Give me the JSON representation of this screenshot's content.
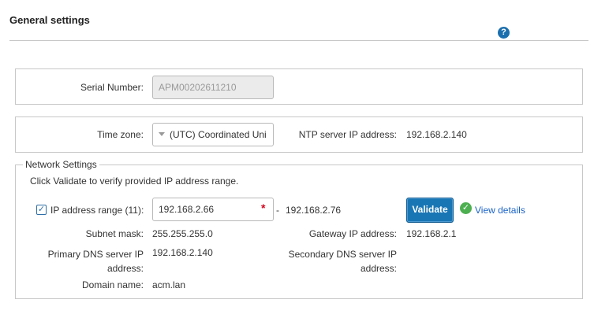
{
  "header": {
    "title": "General settings",
    "help_icon": "question-circle-icon",
    "help_glyph": "?"
  },
  "serial": {
    "label": "Serial Number:",
    "value": "APM00202611210"
  },
  "time": {
    "timezone_label": "Time zone:",
    "timezone_value": "(UTC) Coordinated Uni",
    "ntp_label": "NTP server IP address:",
    "ntp_value": "192.168.2.140"
  },
  "network": {
    "legend": "Network Settings",
    "instructions": "Click Validate to verify provided IP address range.",
    "ip_range_label": "IP address range (11):",
    "ip_range_checked": true,
    "ip_range_start": "192.168.2.66",
    "required_mark": "*",
    "range_separator": "-",
    "ip_range_end": "192.168.2.76",
    "validate_label": "Validate",
    "view_details_label": "View details",
    "subnet_label": "Subnet mask:",
    "subnet_value": "255.255.255.0",
    "gateway_label": "Gateway IP address:",
    "gateway_value": "192.168.2.1",
    "primary_dns_label_1": "Primary DNS server IP",
    "primary_dns_label_2": "address:",
    "primary_dns_value": "192.168.2.140",
    "secondary_dns_label_1": "Secondary DNS server IP",
    "secondary_dns_label_2": "address:",
    "secondary_dns_value": "",
    "domain_label": "Domain name:",
    "domain_value": "acm.lan"
  },
  "colors": {
    "accent": "#1976b5",
    "link": "#1a63c6",
    "success": "#4caf50",
    "required": "#d0021b"
  }
}
